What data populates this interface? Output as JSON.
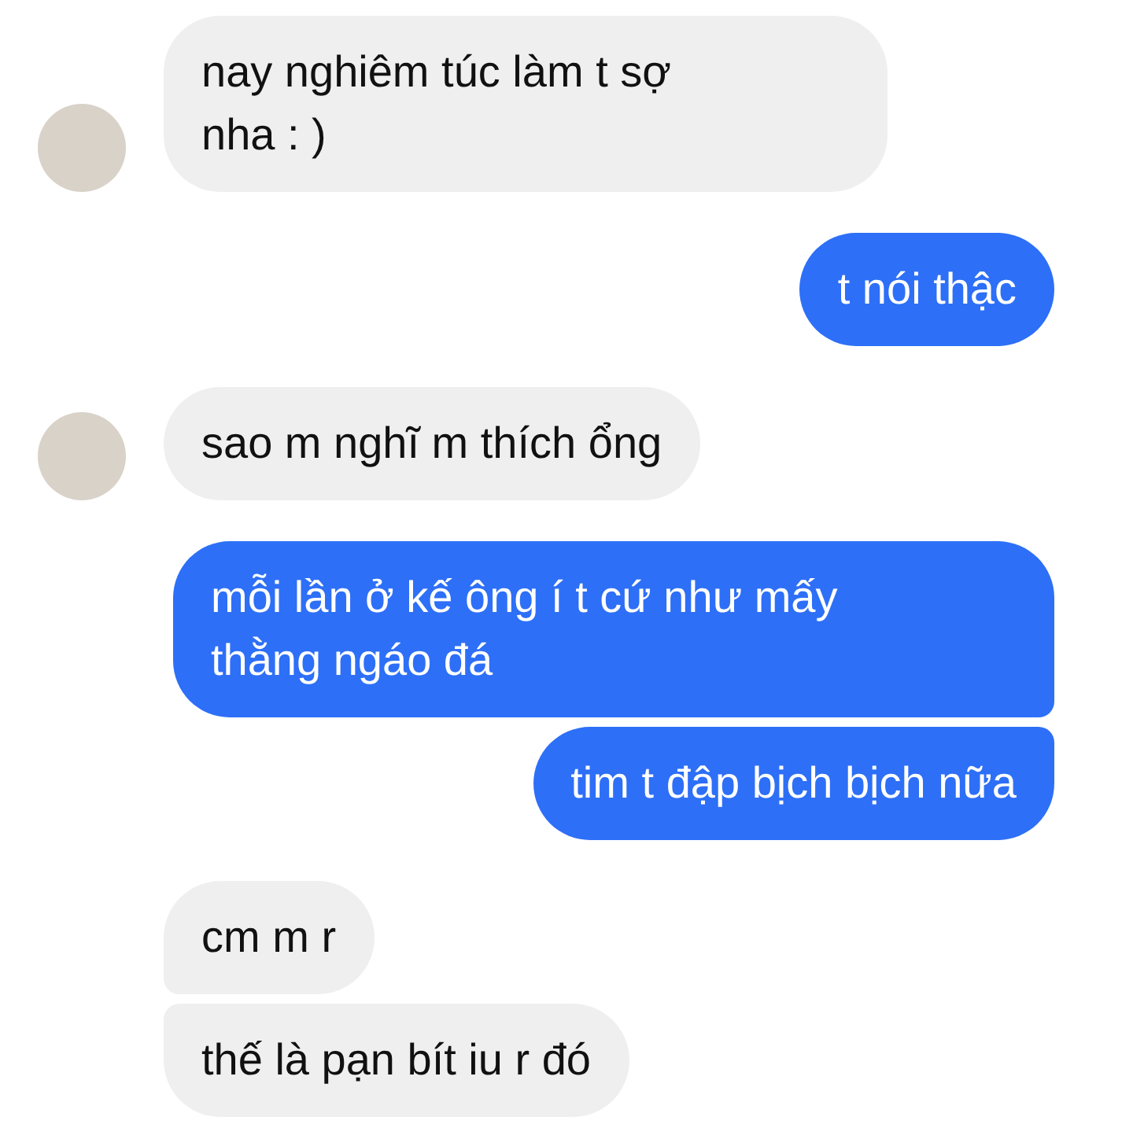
{
  "groups": [
    {
      "kind": "received",
      "messages": [
        {
          "lines": [
            "nay nghiêm túc làm t sợ",
            "nha : )"
          ],
          "avatar": true
        }
      ]
    },
    {
      "kind": "sent",
      "messages": [
        {
          "lines": [
            "t nói thậc"
          ],
          "avatar": false
        }
      ]
    },
    {
      "kind": "received",
      "messages": [
        {
          "lines": [
            "sao m nghĩ m thích ổng"
          ],
          "avatar": true
        }
      ]
    },
    {
      "kind": "sent",
      "messages": [
        {
          "lines": [
            "mỗi lần ở kế ông í t cứ như mấy",
            "thằng ngáo đá"
          ],
          "avatar": false
        },
        {
          "lines": [
            "tim t đập bịch bịch nữa"
          ],
          "avatar": false
        }
      ]
    },
    {
      "kind": "received",
      "messages": [
        {
          "lines": [
            "cm m r"
          ],
          "avatar": false
        },
        {
          "lines": [
            "thế là pạn bít iu r đó"
          ],
          "avatar": false
        }
      ]
    }
  ]
}
